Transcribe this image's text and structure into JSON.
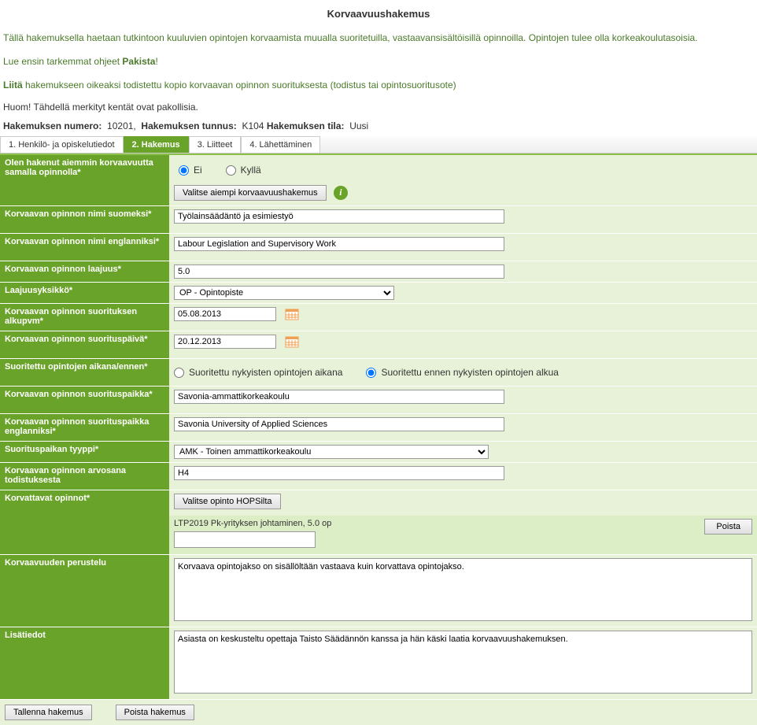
{
  "page": {
    "title": "Korvaavuushakemus",
    "intro1": "Tällä hakemuksella haetaan tutkintoon kuuluvien opintojen korvaamista muualla suoritetuilla, vastaavansisältöisillä opinnoilla. Opintojen tulee olla korkeakoulutasoisia.",
    "intro2_pre": "Lue ensin tarkemmat ohjeet ",
    "intro2_bold": "Pakista",
    "intro2_post": "!",
    "intro3_bold": "Liitä",
    "intro3_rest": " hakemukseen oikeaksi todistettu kopio korvaavan opinnon suorituksesta (todistus tai opintosuoritusote)",
    "note": "Huom! Tähdellä merkityt kentät ovat pakollisia."
  },
  "meta": {
    "num_label": "Hakemuksen numero:",
    "num_value": "10201,",
    "id_label": "Hakemuksen tunnus:",
    "id_value": "K104",
    "state_label": "Hakemuksen tila:",
    "state_value": "Uusi"
  },
  "tabs": {
    "t1": "1. Henkilö- ja opiskelutiedot",
    "t2": "2. Hakemus",
    "t3": "3. Liitteet",
    "t4": "4. Lähettäminen"
  },
  "form": {
    "prev_applied_label": "Olen hakenut aiemmin korvaavuutta samalla opinnolla*",
    "radio_no": "Ei",
    "radio_yes": "Kyllä",
    "choose_prev_btn": "Valitse aiempi korvaavuushakemus",
    "name_fi_label": "Korvaavan opinnon nimi suomeksi*",
    "name_fi_value": "Työlainsäädäntö ja esimiestyö",
    "name_en_label": "Korvaavan opinnon nimi englanniksi*",
    "name_en_value": "Labour Legislation and Supervisory Work",
    "extent_label": "Korvaavan opinnon laajuus*",
    "extent_value": "5.0",
    "unit_label": "Laajuusyksikkö*",
    "unit_value": "OP - Opintopiste",
    "start_label": "Korvaavan opinnon suorituksen alkupvm*",
    "start_value": "05.08.2013",
    "end_label": "Korvaavan opinnon suorituspäivä*",
    "end_value": "20.12.2013",
    "timing_label": "Suoritettu opintojen aikana/ennen*",
    "timing_during": "Suoritettu nykyisten opintojen aikana",
    "timing_before": "Suoritettu ennen nykyisten opintojen alkua",
    "place_fi_label": "Korvaavan opinnon suorituspaikka*",
    "place_fi_value": "Savonia-ammattikorkeakoulu",
    "place_en_label": "Korvaavan opinnon suorituspaikka englanniksi*",
    "place_en_value": "Savonia University of Applied Sciences",
    "place_type_label": "Suorituspaikan tyyppi*",
    "place_type_value": "AMK - Toinen ammattikorkeakoulu",
    "grade_label": "Korvaavan opinnon arvosana todistuksesta",
    "grade_value": "H4",
    "replaced_label": "Korvattavat opinnot*",
    "hops_btn": "Valitse opinto HOPSilta",
    "course_text": "LTP2019 Pk-yrityksen johtaminen, 5.0 op",
    "delete_btn": "Poista",
    "justification_label": "Korvaavuuden perustelu",
    "justification_value": "Korvaava opintojakso on sisällöltään vastaava kuin korvattava opintojakso.",
    "extra_label": "Lisätiedot",
    "extra_value": "Asiasta on keskusteltu opettaja Taisto Säädännön kanssa ja hän käski laatia korvaavuushakemuksen."
  },
  "buttons": {
    "save": "Tallenna hakemus",
    "delete": "Poista hakemus"
  }
}
